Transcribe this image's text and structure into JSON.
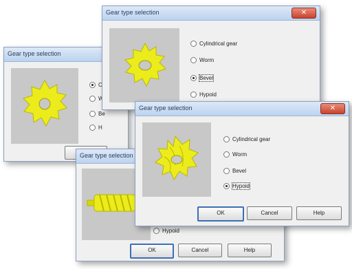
{
  "dialog": {
    "title": "Gear type selection",
    "close_glyph": "✕"
  },
  "options": {
    "cylindrical": "Cylindrical gear",
    "worm": "Worm",
    "bevel": "Bevel",
    "hypoid": "Hypoid"
  },
  "partial": {
    "cylindrical": "Cy",
    "worm": "W",
    "bevel": "Be",
    "hypoid": "H"
  },
  "buttons": {
    "ok": "OK",
    "cancel": "Cancel",
    "help": "Help"
  },
  "colors": {
    "gear": "#ecec1c",
    "gear_shadow": "#b8b800",
    "panel": "#c8c8c8"
  }
}
